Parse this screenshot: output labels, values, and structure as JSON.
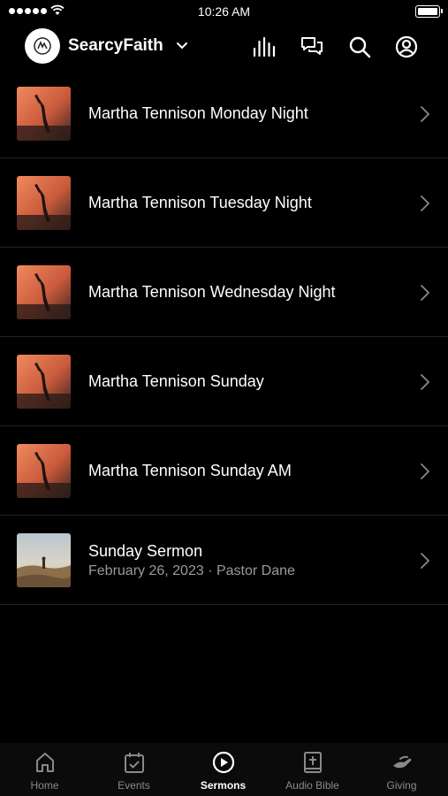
{
  "status_bar": {
    "time": "10:26 AM"
  },
  "header": {
    "app_name": "SearcyFaith",
    "icons": [
      "audio-bars-icon",
      "chat-icon",
      "search-icon",
      "profile-icon"
    ]
  },
  "sermons": [
    {
      "title": "Martha Tennison Monday Night",
      "subtitle": "",
      "thumb": "worship"
    },
    {
      "title": "Martha Tennison Tuesday Night",
      "subtitle": "",
      "thumb": "worship"
    },
    {
      "title": "Martha Tennison Wednesday Night",
      "subtitle": "",
      "thumb": "worship"
    },
    {
      "title": "Martha Tennison Sunday",
      "subtitle": "",
      "thumb": "worship"
    },
    {
      "title": "Martha Tennison Sunday AM",
      "subtitle": "",
      "thumb": "worship"
    },
    {
      "title": "Sunday Sermon",
      "subtitle": "February 26, 2023 · Pastor Dane",
      "thumb": "landscape"
    }
  ],
  "tabbar": {
    "tabs": [
      {
        "label": "Home",
        "icon": "home-icon",
        "active": false
      },
      {
        "label": "Events",
        "icon": "calendar-icon",
        "active": false
      },
      {
        "label": "Sermons",
        "icon": "play-circle-icon",
        "active": true
      },
      {
        "label": "Audio Bible",
        "icon": "bible-icon",
        "active": false
      },
      {
        "label": "Giving",
        "icon": "giving-hand-icon",
        "active": false
      }
    ]
  },
  "colors": {
    "background": "#000000",
    "divider": "#222222",
    "muted_text": "#9a9a9a",
    "inactive_tab": "#8a8a8a"
  }
}
